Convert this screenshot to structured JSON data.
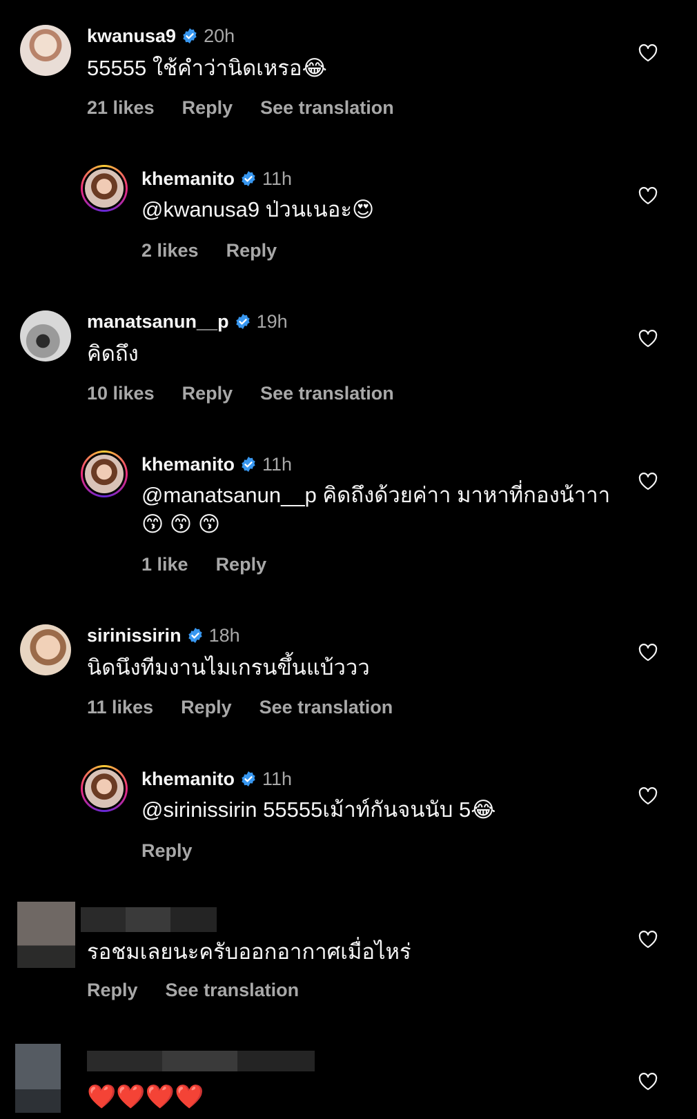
{
  "comments": [
    {
      "username": "kwanusa9",
      "time": "20h",
      "text": "55555 ใช้คำว่านิดเหรอ",
      "emoji": "😂",
      "likes": "21 likes",
      "reply": "Reply",
      "translate": "See translation"
    },
    {
      "username": "khemanito",
      "time": "11h",
      "text": "@kwanusa9 ป่วนเนอะ",
      "emoji": "😍",
      "likes": "2 likes",
      "reply": "Reply"
    },
    {
      "username": "manatsanun__p",
      "time": "19h",
      "text": "คิดถึง",
      "likes": "10 likes",
      "reply": "Reply",
      "translate": "See translation"
    },
    {
      "username": "khemanito",
      "time": "11h",
      "text": "@manatsanun__p คิดถึงด้วยค่าา มาหาที่กองน้าาา",
      "emoji": "😙 😙 😙",
      "likes": "1 like",
      "reply": "Reply"
    },
    {
      "username": "sirinissirin",
      "time": "18h",
      "text": "นิดนึงทีมงานไมเกรนขึ้นแบ้ววว",
      "likes": "11 likes",
      "reply": "Reply",
      "translate": "See translation"
    },
    {
      "username": "khemanito",
      "time": "11h",
      "text": "@sirinissirin 55555เม้าท์กันจนนับ 5",
      "emoji": "😂",
      "reply": "Reply"
    },
    {
      "text": "รอชมเลยนะครับออกอากาศเมื่อไหร่",
      "reply": "Reply",
      "translate": "See translation"
    },
    {
      "text": "❤️❤️❤️❤️"
    }
  ],
  "icons": {
    "heart": "heart-outline-icon",
    "verified": "verified-badge-icon"
  },
  "colors": {
    "background": "#000000",
    "text": "#f5f5f5",
    "muted": "#a8a8a8",
    "verified": "#3897f0"
  }
}
